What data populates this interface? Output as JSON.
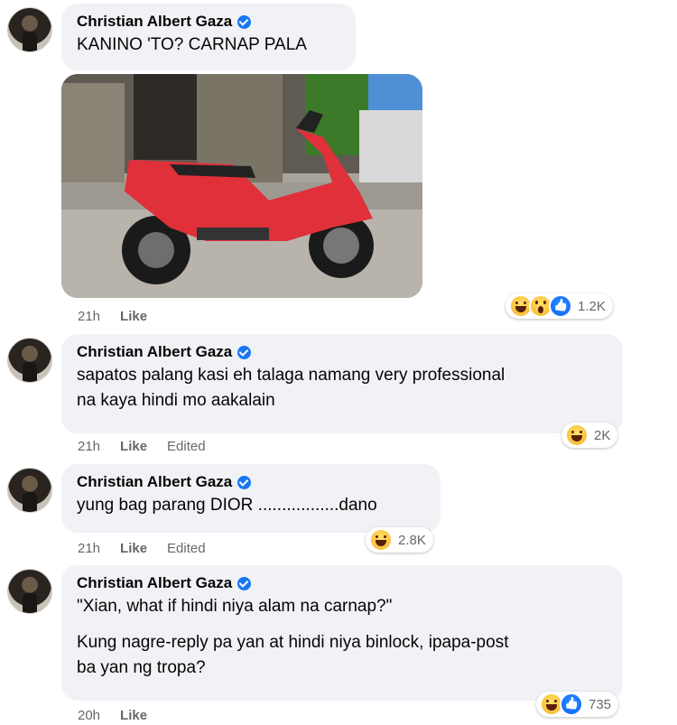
{
  "comments": [
    {
      "author": "Christian Albert Gaza",
      "text": "KANINO 'TO? CARNAP PALA",
      "time": "21h",
      "like_label": "Like",
      "reaction_count": "1.2K",
      "reactions": [
        "haha-icon",
        "wow-icon",
        "like-icon"
      ]
    },
    {
      "author": "Christian Albert Gaza",
      "text_lines": [
        "sapatos palang kasi eh talaga namang very professional",
        "na kaya hindi mo aakalain"
      ],
      "time": "21h",
      "like_label": "Like",
      "edited_label": "Edited",
      "reaction_count": "2K",
      "reactions": [
        "haha-icon"
      ]
    },
    {
      "author": "Christian Albert Gaza",
      "text": "yung bag parang DIOR .................dano",
      "time": "21h",
      "like_label": "Like",
      "edited_label": "Edited",
      "reaction_count": "2.8K",
      "reactions": [
        "haha-icon"
      ]
    },
    {
      "author": "Christian Albert Gaza",
      "text_p1": "\"Xian, what if hindi niya alam na carnap?\"",
      "text_p2_lines": [
        "Kung nagre-reply pa yan at hindi niya binlock, ipapa-post",
        "ba yan ng tropa?"
      ],
      "time": "20h",
      "like_label": "Like",
      "reaction_count": "735",
      "reactions": [
        "haha-icon",
        "like-icon"
      ]
    }
  ],
  "colors": {
    "bubble": "#f0f2f5",
    "meta": "#65676b",
    "verified": "#1877f2",
    "scooter": "#e0303a"
  }
}
